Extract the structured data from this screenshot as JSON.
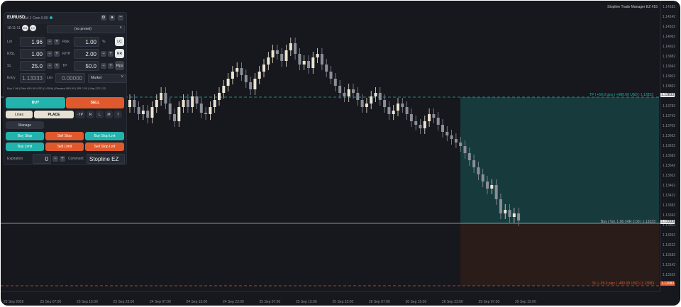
{
  "window": {
    "symbol": "EURUSD",
    "timeframe": "H1",
    "tab_title": "Euro vs US Doll",
    "panel_subtitle_1": "Sd 1",
    "panel_subtitle_2": "Com 0.00",
    "top_right_title": "Stopline Trade Manager EZ #15"
  },
  "panel": {
    "time": "18:11:11",
    "mode_a": "EX",
    "mode_b": "LC",
    "preset": "(no preset)",
    "lot_label": "Lot",
    "lot_value": "1.96",
    "risk_label": "Risk",
    "risk_value": "1.00",
    "risk_unit": "%",
    "risk_btn": "LC",
    "rsl_label": "R/SL",
    "rsl_value": "1.00",
    "rtp_label": "R/TP",
    "rtp_value": "2.00",
    "rr_btn": "RR",
    "sl_label": "SL",
    "sl_value": "25.0",
    "tp_label": "TP",
    "tp_value": "50.0",
    "pips_btn": "Pips",
    "entry_label": "Entry",
    "entry_value": "1.13333",
    "lim_label": "Lim",
    "lim_value": "0.00000",
    "order_type": "Market",
    "summary": "Buy 1.96 | Risk 490.00 USD (1.00%) | Reward 980.00 | RR 2.00 | Mrg 2221.33",
    "buy": "BUY",
    "sell": "SELL",
    "lines": "Lines",
    "place": "PLACE",
    "minus_tp": "-TP",
    "r_btn": "R",
    "l_btn": "L",
    "m_btn": "M",
    "t_btn": "T",
    "manage": "Manage",
    "buy_stop": "Buy Stop",
    "sell_stop": "Sell Stop",
    "buy_stop_limit": "Buy Stop Lmt",
    "buy_limit": "Buy Limit",
    "sell_limit": "Sell Limit",
    "sell_stop_limit": "Sell Stop Lmt",
    "expiration_label": "Expiration",
    "expiration_value": "0",
    "comment_label": "Comment",
    "comment_value": "Stopline EZ"
  },
  "lines": {
    "tp_text": "TP | +50.0 pips | +980.00 USD | 1.13833",
    "buy_text": "Buy | Vol. 1.96 | RR 2.00 | 1.13333",
    "sl_text": "SL | -25.0 pips | -490.00 USD | 1.13083",
    "tp_price": "1.13833",
    "buy_price": "1.13333",
    "sl_price": "1.13083"
  },
  "price_axis": [
    "1.14183",
    "1.14142",
    "1.14102",
    "1.14062",
    "1.14022",
    "1.13982",
    "1.13942",
    "1.13902",
    "1.13862",
    "1.13822",
    "1.13782",
    "1.13742",
    "1.13702",
    "1.13662",
    "1.13622",
    "1.13582",
    "1.13542",
    "1.13502",
    "1.13462",
    "1.13422",
    "1.13382",
    "1.13342",
    "1.13302",
    "1.13262",
    "1.13222",
    "1.13182",
    "1.13142",
    "1.13102",
    "1.13062"
  ],
  "time_axis": [
    "22 Sep 2026",
    "23 Sep 07:00",
    "23 Sep 15:00",
    "23 Sep 23:00",
    "24 Sep 07:00",
    "24 Sep 15:00",
    "24 Sep 23:00",
    "25 Sep 07:00",
    "25 Sep 15:00",
    "25 Sep 23:00",
    "26 Sep 07:00",
    "26 Sep 15:00",
    "26 Sep 23:00",
    "29 Sep 07:00",
    "29 Sep 15:00"
  ],
  "colors": {
    "bg": "#16181d",
    "bull": "#ece4d2",
    "bear": "#8a8f99",
    "buy": "#22b3ad",
    "sell": "#e0592c",
    "tp_zone": "#173b3c",
    "sl_zone": "#2a1c19"
  }
}
